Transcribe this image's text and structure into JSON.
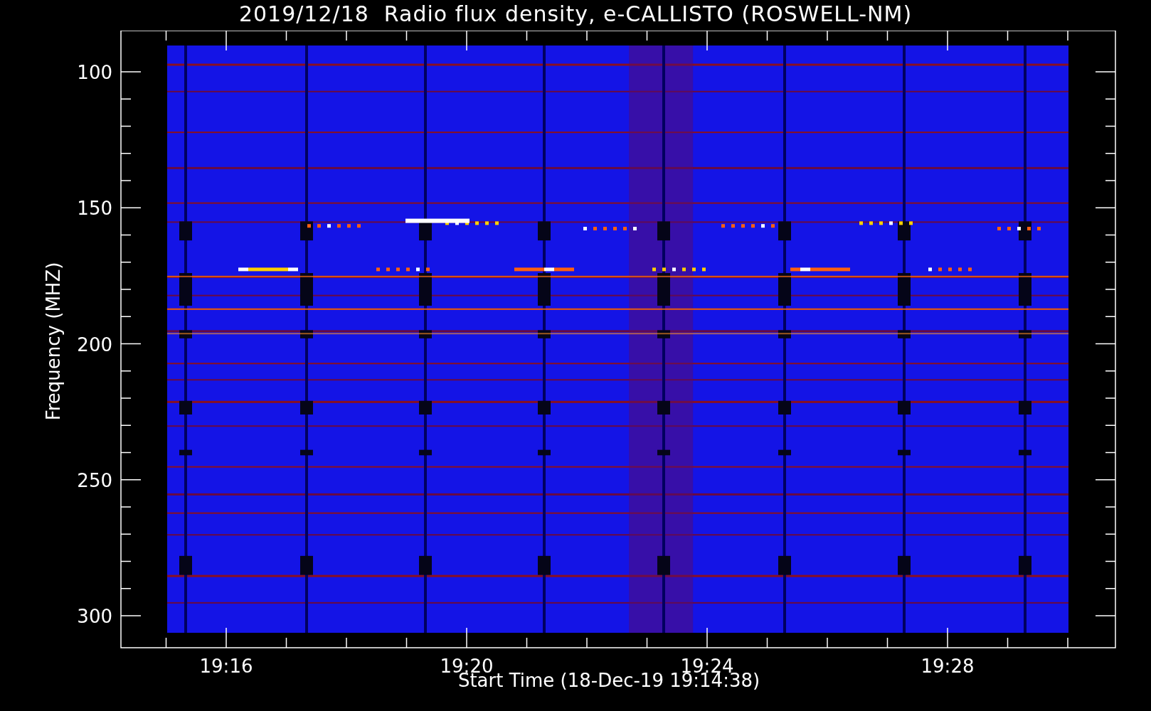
{
  "title": "2019/12/18  Radio flux density, e-CALLISTO (ROSWELL-NM)",
  "y_axis": {
    "label": "Frequency (MHZ)",
    "ticks": [
      "100",
      "150",
      "200",
      "250",
      "300"
    ]
  },
  "x_axis": {
    "label": "Start Time (18-Dec-19 19:14:38)",
    "ticks": [
      "19:16",
      "19:20",
      "19:24",
      "19:28"
    ]
  }
}
